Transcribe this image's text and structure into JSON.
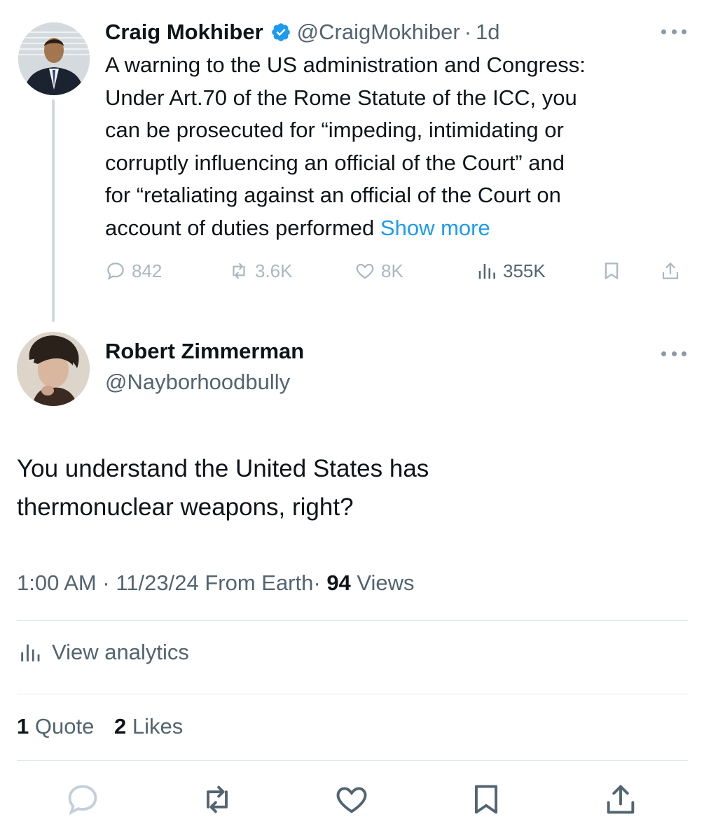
{
  "parent_tweet": {
    "author_name": "Craig Mokhiber",
    "handle": "@CraigMokhiber",
    "separator": "·",
    "time": "1d",
    "lines": [
      "A warning to the US administration and Congress:",
      "Under Art.70 of the Rome Statute of the ICC, you",
      "can be prosecuted for “impeding, intimidating or",
      "corruptly influencing an official of the Court” and",
      "for “retaliating against an official of the Court on",
      "account of duties performed"
    ],
    "show_more": "Show more",
    "stats": {
      "replies": "842",
      "reposts": "3.6K",
      "likes": "8K",
      "views": "355K"
    }
  },
  "reply_tweet": {
    "author_name": "Robert Zimmerman",
    "handle": "@Nayborhoodbully",
    "text_line1": "You understand the United States has",
    "text_line2": "thermonuclear weapons, right?",
    "meta": {
      "time": "1:00 AM",
      "dot1": "·",
      "date": "11/23/24",
      "source": "From Earth",
      "dot2": "·",
      "views_count": "94",
      "views_label": "Views"
    },
    "analytics_label": "View analytics",
    "quotes_count": "1",
    "quotes_label": "Quote",
    "likes_count": "2",
    "likes_label": "Likes"
  },
  "icons": {
    "reply": "reply-icon",
    "repost": "repost-icon",
    "like": "heart-icon",
    "views": "bar-chart-icon",
    "bookmark": "bookmark-icon",
    "share": "share-icon",
    "verified": "verified-badge-icon",
    "more": "more-icon"
  },
  "colors": {
    "accent": "#1d9bf0",
    "text": "#0f1419",
    "muted": "#536471",
    "faded": "#aab8c2",
    "divider": "#e1e8ed"
  }
}
